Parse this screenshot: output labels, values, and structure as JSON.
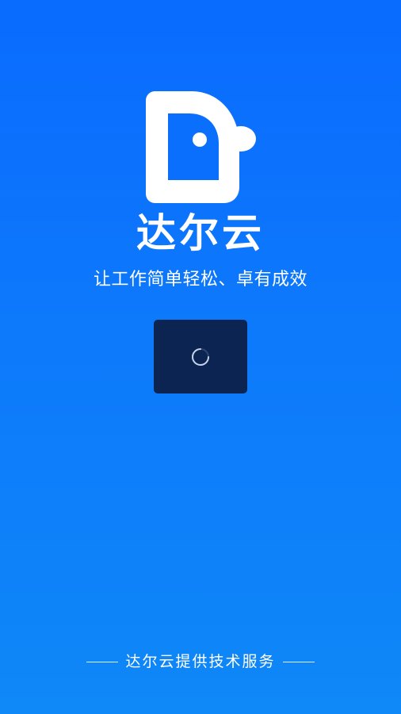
{
  "splash": {
    "app_name": "达尔云",
    "slogan": "让工作简单轻松、卓有成效",
    "logo_icon": "dal-logo-icon",
    "loading_icon": "loading-spinner-icon",
    "footer_text": "达尔云提供技术服务"
  },
  "colors": {
    "background_top": "#0a6bff",
    "background_bottom": "#0f88f8",
    "loading_box": "#0c2452",
    "text": "#ffffff"
  }
}
